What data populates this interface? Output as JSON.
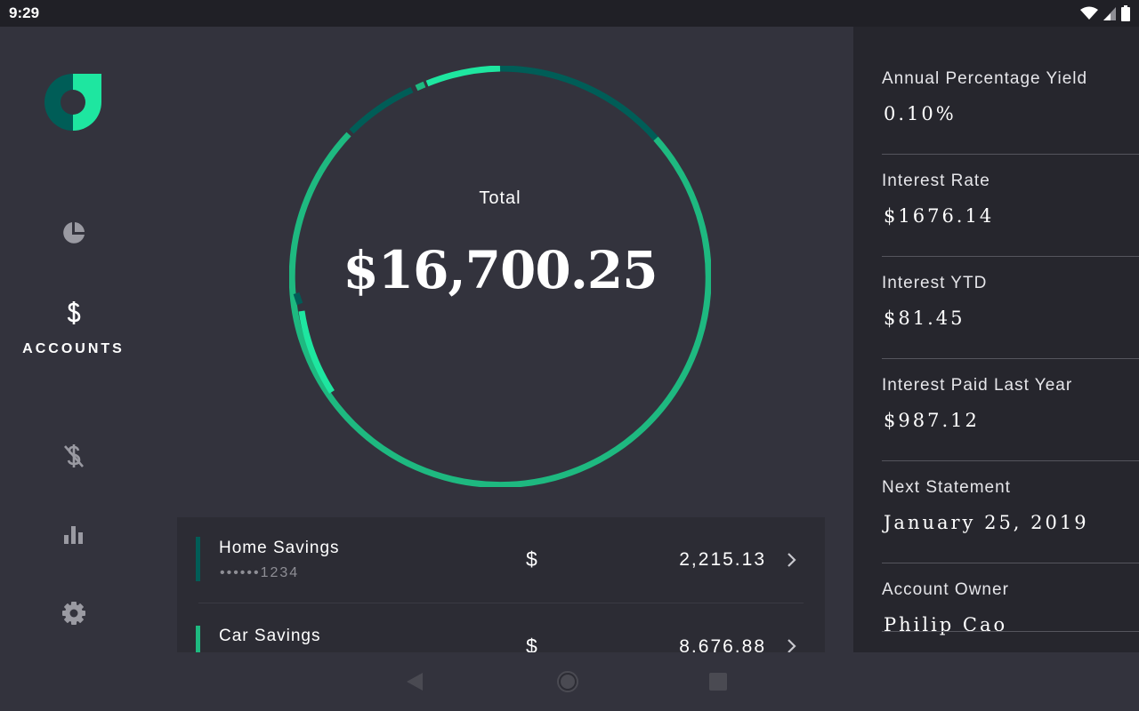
{
  "status_bar": {
    "time": "9:29",
    "icons": [
      "wifi-icon",
      "signal-icon",
      "battery-icon"
    ]
  },
  "nav": {
    "logo": "rally-logo",
    "items": [
      {
        "icon": "pie-chart-icon",
        "label": "",
        "selected": false
      },
      {
        "icon": "dollar-icon",
        "label": "ACCOUNTS",
        "selected": true
      },
      {
        "icon": "money-off-icon",
        "label": "",
        "selected": false
      },
      {
        "icon": "bar-chart-icon",
        "label": "",
        "selected": false
      },
      {
        "icon": "gear-icon",
        "label": "",
        "selected": false
      }
    ]
  },
  "overview": {
    "label": "Total",
    "amount": "$16,700.25"
  },
  "accounts": [
    {
      "name": "Home Savings",
      "number": "••••••1234",
      "currency": "$",
      "amount": "2,215.13",
      "color": "#005D57"
    },
    {
      "name": "Car Savings",
      "number": "",
      "currency": "$",
      "amount": "8,676.88",
      "color": "#1EB980"
    }
  ],
  "details": [
    {
      "label": "Annual Percentage Yield",
      "value": "0.10%"
    },
    {
      "label": "Interest Rate",
      "value": "$1676.14"
    },
    {
      "label": "Interest YTD",
      "value": "$81.45"
    },
    {
      "label": "Interest Paid Last Year",
      "value": "$987.12"
    },
    {
      "label": "Next Statement",
      "value": "January 25, 2019"
    },
    {
      "label": "Account Owner",
      "value": "Philip Cao"
    }
  ],
  "system_nav": {
    "icons": [
      "back-icon",
      "home-icon",
      "recents-icon"
    ]
  },
  "colors": {
    "background": "#33333D",
    "panel": "#26262D",
    "card": "#2C2C34",
    "accent_green": "#1EB980",
    "accent_bright": "#1EE6A0",
    "accent_dark": "#005D57"
  }
}
